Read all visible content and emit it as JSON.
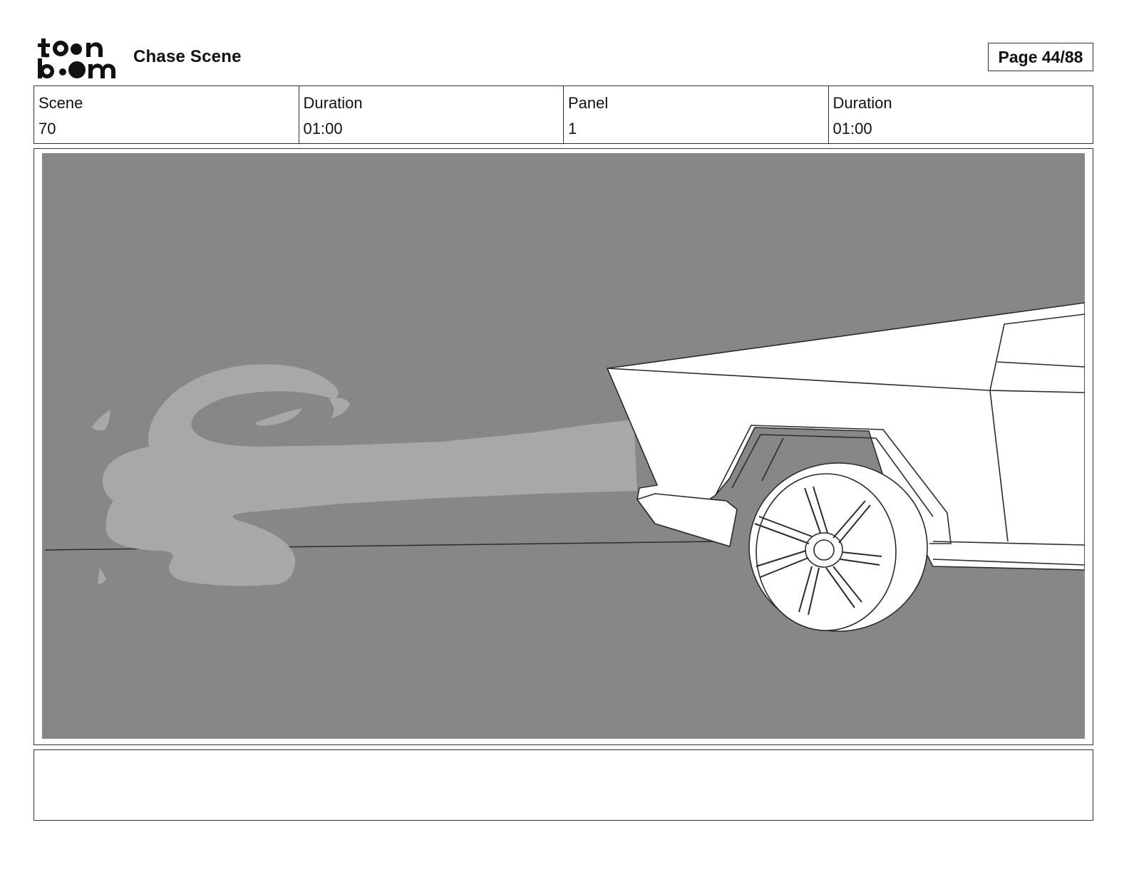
{
  "header": {
    "logo_text": "toon boom",
    "title": "Chase Scene",
    "page_label": "Page 44/88"
  },
  "info": {
    "scene_label": "Scene",
    "scene_value": "70",
    "scene_duration_label": "Duration",
    "scene_duration_value": "01:00",
    "panel_label": "Panel",
    "panel_value": "1",
    "panel_duration_label": "Duration",
    "panel_duration_value": "01:00"
  },
  "panel": {
    "background_color": "#878787",
    "smoke_color": "#a8a8a8",
    "line_color": "#2b2b2b"
  },
  "notes": {
    "text": ""
  }
}
